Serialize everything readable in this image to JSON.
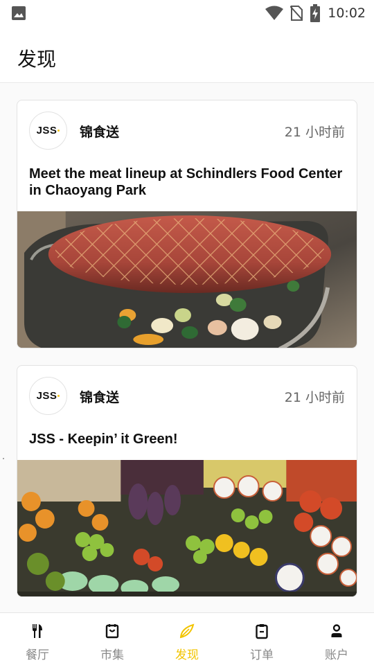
{
  "status_bar": {
    "time": "10:02",
    "icons": [
      "image-icon",
      "wifi-icon",
      "no-sim-icon",
      "battery-charging-icon"
    ]
  },
  "header": {
    "title": "发现"
  },
  "feed": {
    "posts": [
      {
        "avatar_text": "JSS",
        "author": "锦食送",
        "time": "21 小时前",
        "title": "Meet the meat lineup at Schindlers Food Center in Chaoyang Park",
        "image": "roasted-ham-photo"
      },
      {
        "avatar_text": "JSS",
        "author": "锦食送",
        "time": "21 小时前",
        "title": "JSS - Keepin’ it Green!",
        "image": "fruit-market-photo"
      }
    ]
  },
  "bottom_nav": {
    "items": [
      {
        "label": "餐厅",
        "icon": "fork-knife-icon",
        "active": false
      },
      {
        "label": "市集",
        "icon": "market-bag-icon",
        "active": false
      },
      {
        "label": "发现",
        "icon": "compass-leaf-icon",
        "active": true
      },
      {
        "label": "订单",
        "icon": "clipboard-icon",
        "active": false
      },
      {
        "label": "账户",
        "icon": "person-icon",
        "active": false
      }
    ]
  },
  "colors": {
    "accent": "#f2c400",
    "inactive": "#888888"
  }
}
